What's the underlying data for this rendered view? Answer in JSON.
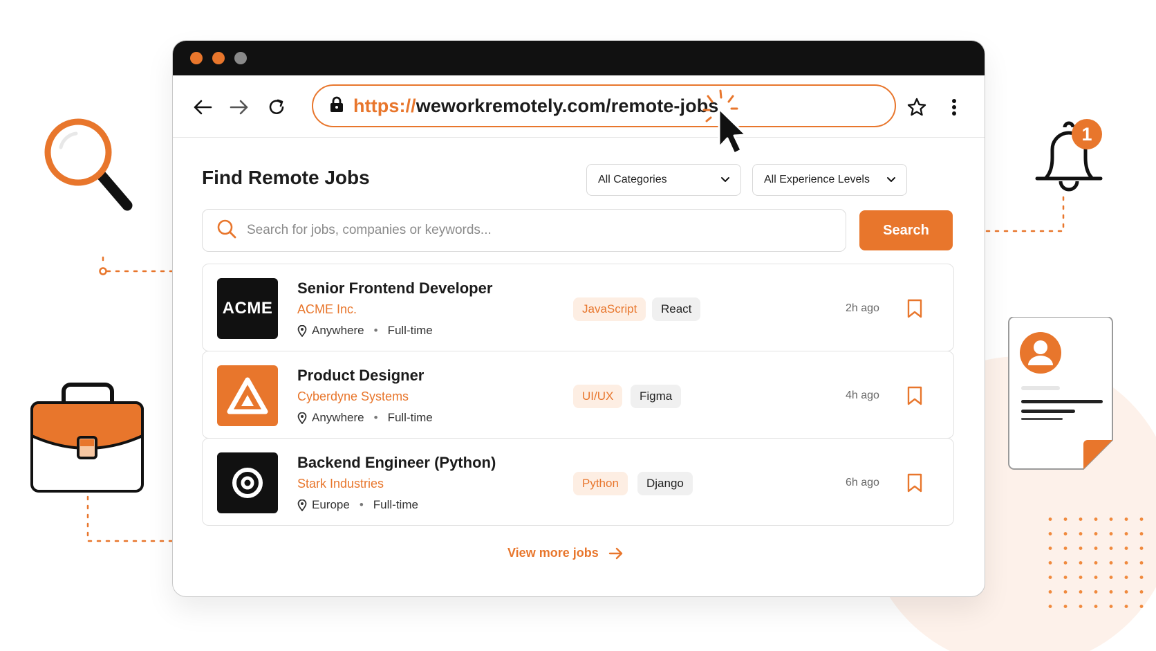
{
  "colors": {
    "accent": "#e8762c",
    "dark": "#111111",
    "light_tag": "#fdeee3"
  },
  "browser": {
    "url_scheme": "https://",
    "url_rest": "weworkremotely.com/remote-jobs",
    "icons": [
      "back-arrow-icon",
      "forward-arrow-icon",
      "reload-icon",
      "lock-icon",
      "star-icon",
      "kebab-menu-icon"
    ]
  },
  "page": {
    "title": "Find Remote Jobs",
    "category_select": "All Categories",
    "experience_select": "All Experience Levels",
    "search_placeholder": "Search for jobs, companies or keywords...",
    "search_button": "Search",
    "view_more": "View more jobs"
  },
  "jobs": [
    {
      "title": "Senior Frontend Developer",
      "company": "ACME Inc.",
      "location": "Anywhere",
      "type": "Full-time",
      "tags": [
        "JavaScript",
        "React"
      ],
      "posted": "2h ago",
      "logo_text": "ACME"
    },
    {
      "title": "Product Designer",
      "company": "Cyberdyne Systems",
      "location": "Anywhere",
      "type": "Full-time",
      "tags": [
        "UI/UX",
        "Figma"
      ],
      "posted": "4h ago"
    },
    {
      "title": "Backend Engineer (Python)",
      "company": "Stark Industries",
      "location": "Europe",
      "type": "Full-time",
      "tags": [
        "Python",
        "Django"
      ],
      "posted": "6h ago"
    }
  ],
  "notification": {
    "count": "1"
  }
}
